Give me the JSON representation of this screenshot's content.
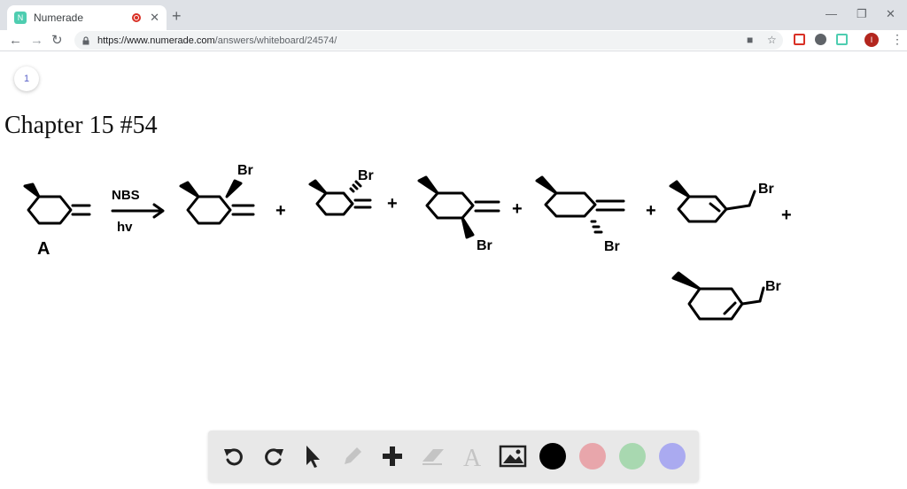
{
  "browser": {
    "tab_title": "Numerade",
    "tab_favicon_letter": "N",
    "new_tab": "+",
    "url_host": "https://www.numerade.com",
    "url_path": "/answers/whiteboard/24574/",
    "profile_initial": "I",
    "accent": "#4ecdb0"
  },
  "page": {
    "page_number": "1",
    "title": "Chapter 15 #54"
  },
  "whiteboard": {
    "labels": {
      "compound": "A",
      "reagent_top": "NBS",
      "reagent_bottom": "hv",
      "br": "Br",
      "plus": "+"
    },
    "tools": [
      "undo-icon",
      "redo-icon",
      "pointer-icon",
      "pencil-icon",
      "add-icon",
      "eraser-icon",
      "text-icon",
      "image-icon"
    ],
    "colors": [
      "#000000",
      "#e8a6ab",
      "#a8d8b0",
      "#aaaaf0"
    ]
  }
}
